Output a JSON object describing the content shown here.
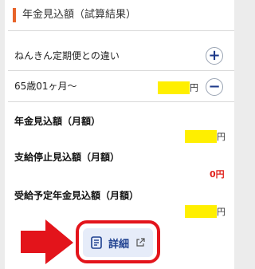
{
  "section": {
    "title": "年金見込額（試算結果）"
  },
  "rows": [
    {
      "label": "ねんきん定期便との違い",
      "button": "+",
      "icon": "plus-icon"
    },
    {
      "label": "65歳01ヶ月〜",
      "unit": "円",
      "button": "−",
      "icon": "minus-icon"
    }
  ],
  "details": {
    "pension": {
      "label": "年金見込額（月額）",
      "unit": "円"
    },
    "suspension": {
      "label": "支給停止見込額（月額）",
      "value": "0円"
    },
    "scheduled": {
      "label": "受給予定年金見込額（月額）",
      "unit": "円"
    }
  },
  "detail_button": {
    "label": "詳細",
    "icon": "document-icon",
    "external_icon": "external-link-icon"
  },
  "colors": {
    "accent": "#e8642a",
    "highlight": "#ffef00",
    "annotation_red": "#e3141b",
    "button_bg": "#e6ecf9",
    "button_text": "#1d3f8f"
  }
}
